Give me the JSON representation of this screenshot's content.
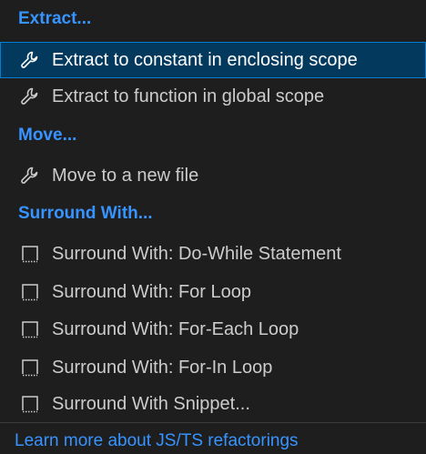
{
  "menu": {
    "groups": [
      {
        "header": "Extract...",
        "items": [
          {
            "label": "Extract to constant in enclosing scope",
            "icon": "wrench-icon",
            "selected": true
          },
          {
            "label": "Extract to function in global scope",
            "icon": "wrench-icon",
            "selected": false
          }
        ]
      },
      {
        "header": "Move...",
        "items": [
          {
            "label": "Move to a new file",
            "icon": "wrench-icon",
            "selected": false
          }
        ]
      },
      {
        "header": "Surround With...",
        "items": [
          {
            "label": "Surround With: Do-While Statement",
            "icon": "snippet-icon",
            "selected": false
          },
          {
            "label": "Surround With: For Loop",
            "icon": "snippet-icon",
            "selected": false
          },
          {
            "label": "Surround With: For-Each Loop",
            "icon": "snippet-icon",
            "selected": false
          },
          {
            "label": "Surround With: For-In Loop",
            "icon": "snippet-icon",
            "selected": false
          },
          {
            "label": "Surround With Snippet...",
            "icon": "snippet-icon",
            "selected": false
          }
        ]
      }
    ],
    "footer_link": "Learn more about JS/TS refactorings"
  },
  "colors": {
    "accent": "#3794ff",
    "selected_bg": "#04395e",
    "background": "#1e1e1f"
  }
}
